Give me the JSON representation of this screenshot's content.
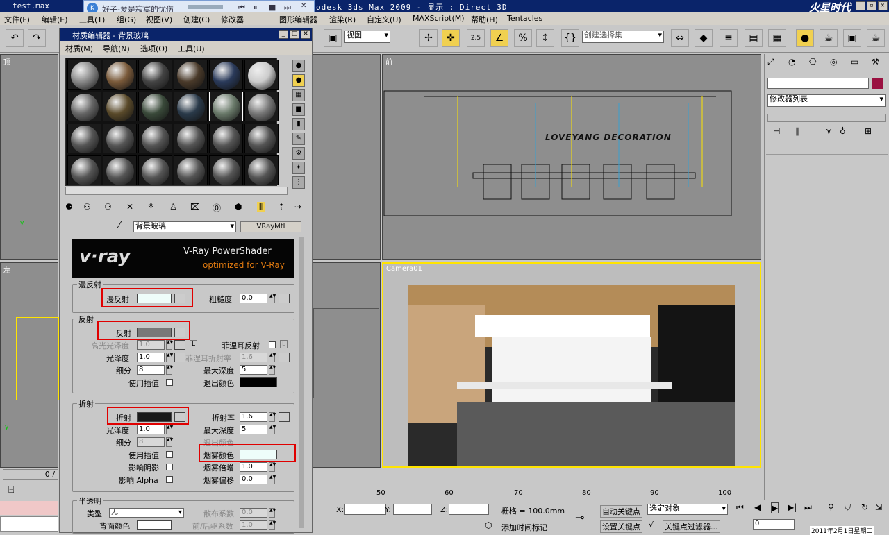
{
  "app": {
    "file_title": "test.max",
    "app_title": "odesk 3ds Max  2009      - 显示 : Direct 3D",
    "logo": "火星时代"
  },
  "music": {
    "song": "好子-爱是寂寞的忧伤"
  },
  "menu": [
    "文件(F)",
    "编辑(E)",
    "工具(T)",
    "组(G)",
    "视图(V)",
    "创建(C)",
    "修改器",
    "图形编辑器",
    "渲染(R)",
    "自定义(U)",
    "MAXScript(M)",
    "帮助(H)",
    "Tentacles"
  ],
  "toolbar": {
    "view_select": "视图",
    "selection_set": "创建选择集",
    "spinner_value": "2.5"
  },
  "viewports": {
    "top": "顶",
    "front": "前",
    "left": "左",
    "camera": "Camera01",
    "logo_text": "LOVEYANG DECORATION"
  },
  "medit": {
    "title": "材质编辑器 - 背景玻璃",
    "menus": [
      "材质(M)",
      "导航(N)",
      "选项(O)",
      "工具(U)"
    ],
    "material_name": "背景玻璃",
    "material_type": "VRayMtl",
    "banner_title": "V-Ray PowerShader",
    "banner_sub": "optimized for V-Ray",
    "banner_logo": "v·ray",
    "diffuse": {
      "group": "漫反射",
      "label": "漫反射",
      "rough_label": "粗糙度",
      "rough": "0.0"
    },
    "reflect": {
      "group": "反射",
      "label": "反射",
      "hilight_label": "高光光泽度",
      "hilight": "1.0",
      "L": "L",
      "fresnel_label": "菲涅耳反射",
      "gloss_label": "光泽度",
      "gloss": "1.0",
      "fresnel_ior_label": "菲涅耳折射率",
      "fresnel_ior": "1.6",
      "subdiv_label": "细分",
      "subdiv": "8",
      "maxdepth_label": "最大深度",
      "maxdepth": "5",
      "interp_label": "使用插值",
      "exit_label": "退出颜色"
    },
    "refract": {
      "group": "折射",
      "label": "折射",
      "ior_label": "折射率",
      "ior": "1.6",
      "gloss_label": "光泽度",
      "gloss": "1.0",
      "maxdepth_label": "最大深度",
      "maxdepth": "5",
      "subdiv_label": "细分",
      "subdiv": "8",
      "exit_label": "退出颜色",
      "interp_label": "使用插值",
      "fog_label": "烟雾颜色",
      "shadows_label": "影响阴影",
      "fogmult_label": "烟雾倍增",
      "fogmult": "1.0",
      "alpha_label": "影响 Alpha",
      "fogbias_label": "烟雾偏移",
      "fogbias": "0.0"
    },
    "translucent": {
      "group": "半透明",
      "type_label": "类型",
      "type": "无",
      "scatter_label": "散布系数",
      "scatter": "0.0",
      "back_label": "背面颜色",
      "fb_label": "前/后驱系数",
      "fb": "1.0"
    }
  },
  "command": {
    "modifier_list": "修改器列表"
  },
  "timeline": {
    "frame": "0 / ",
    "ticks": [
      "50",
      "60",
      "70",
      "80",
      "90",
      "100"
    ]
  },
  "status": {
    "x": "X:",
    "y": "Y:",
    "z": "Z:",
    "grid": "栅格 = 100.0mm",
    "auto_key": "自动关键点",
    "sel_obj": "选定对象",
    "set_key": "设置关键点",
    "key_filter": "关键点过滤器...",
    "add_tag": "添加时间标记",
    "frame_val": "0",
    "date": "2011年2月1日星期二"
  },
  "colors": {
    "title": "#0a246a",
    "accent": "#ffe400",
    "red": "#e00000",
    "fog": "#eefdfa",
    "diffuse": "#eefdfa",
    "reflect": "#787878",
    "refract": "#1a1a1a"
  }
}
